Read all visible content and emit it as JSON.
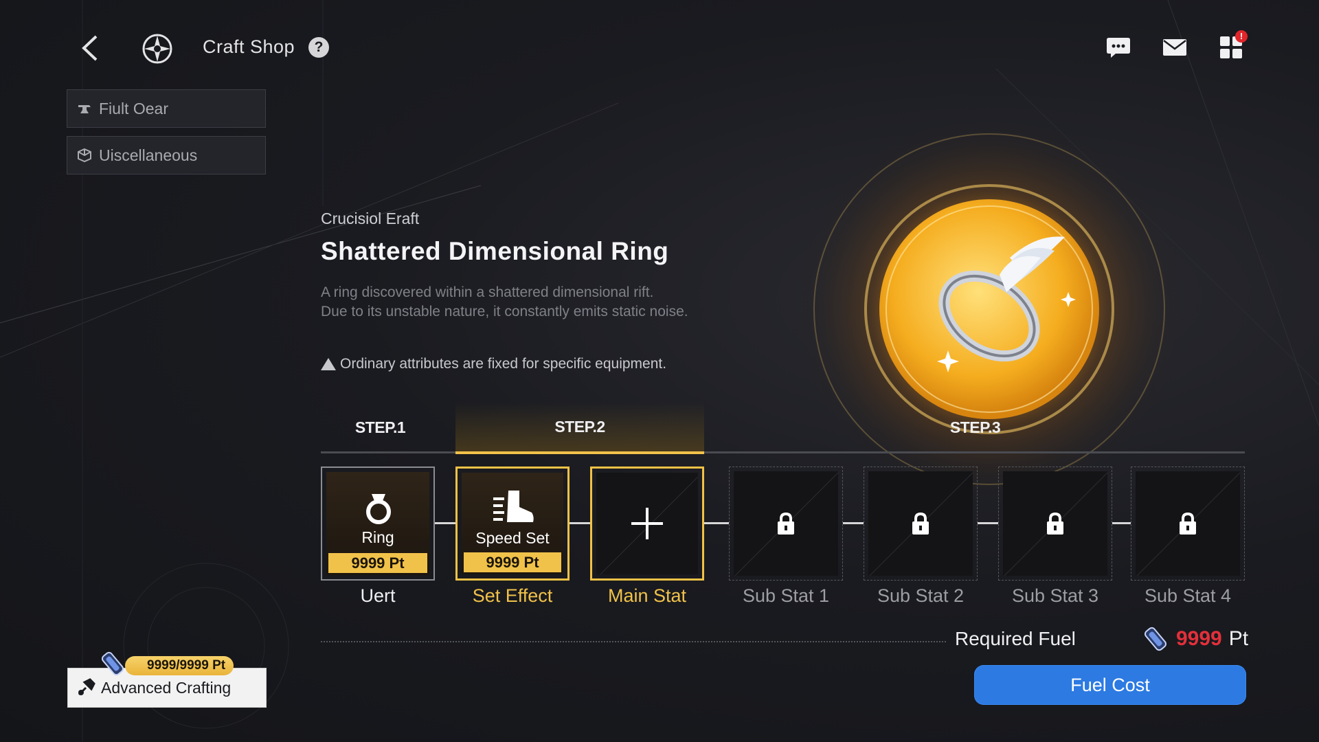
{
  "header": {
    "title": "Craft Shop",
    "help_symbol": "?",
    "notification_badge": "!"
  },
  "sidebar": {
    "items": [
      {
        "label": "Fiult Oear",
        "icon": "anvil-icon"
      },
      {
        "label": "Uiscellaneous",
        "icon": "box-icon"
      }
    ]
  },
  "item": {
    "category": "Crucisiol Eraft",
    "name": "Shattered Dimensional Ring",
    "description_line1": "A ring discovered within a shattered dimensional rift.",
    "description_line2": "Due to its unstable nature, it constantly emits static noise.",
    "warning": "Ordinary attributes are fixed for specific equipment."
  },
  "steps": [
    "STEP.1",
    "STEP.2",
    "STEP.3"
  ],
  "slots": [
    {
      "name": "Ring",
      "points": "9999 Pt",
      "label": "Uert",
      "icon": "ring-icon"
    },
    {
      "name": "Speed Set",
      "points": "9999 Pt",
      "label": "Set Effect",
      "icon": "boot-icon"
    },
    {
      "label": "Main Stat",
      "icon": "plus-icon"
    },
    {
      "label": "Sub Stat 1",
      "icon": "lock-icon"
    },
    {
      "label": "Sub Stat 2",
      "icon": "lock-icon"
    },
    {
      "label": "Sub Stat 3",
      "icon": "lock-icon"
    },
    {
      "label": "Sub Stat 4",
      "icon": "lock-icon"
    }
  ],
  "requirement": {
    "label": "Required Fuel",
    "amount": "9999",
    "unit": "Pt"
  },
  "craft_button": "Fuel Cost",
  "advanced": {
    "points": "9999/9999 Pt",
    "label": "Advanced Crafting"
  },
  "colors": {
    "accent_gold": "#f1c24a",
    "button_blue": "#2c7ae2",
    "cost_red": "#e3303a"
  }
}
